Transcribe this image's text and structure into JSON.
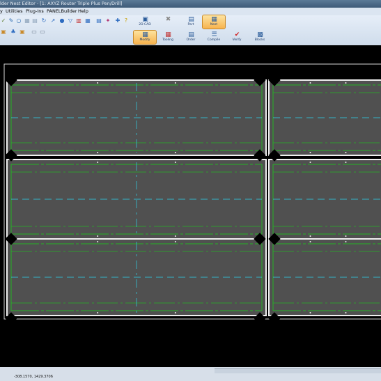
{
  "window": {
    "title": "lder Nest Editor - [1: AXYZ Router Triple Plus Pen/Drill]"
  },
  "menu": {
    "items": [
      "y",
      "Utilities",
      "Plug-Ins",
      "PANELBuilder",
      "Help"
    ]
  },
  "toolbar": {
    "row1_icons": [
      "wand-icon",
      "pencil-icon",
      "circle-icon",
      "grid-icon",
      "rotate-icon",
      "arrow-icon",
      "info-icon",
      "filter-icon",
      "ruler-icon",
      "table-icon",
      "chart-icon",
      "brush-icon",
      "text-icon",
      "help-icon"
    ],
    "row2_icons": [
      "panel-icon",
      "component-icon",
      "sheet-icon",
      "layout-icon",
      "toggle-icon"
    ]
  },
  "ribbon": {
    "top": [
      {
        "label": "2D CAD",
        "icon": "cad-icon",
        "active": false
      },
      {
        "label": "",
        "icon": "tools-icon",
        "active": false
      },
      {
        "label": "Part",
        "icon": "part-icon",
        "active": false
      },
      {
        "label": "Nest",
        "icon": "nest-icon",
        "active": true
      }
    ],
    "bottom": [
      {
        "label": "Modify",
        "icon": "modify-icon",
        "active": true
      },
      {
        "label": "Tooling",
        "icon": "tooling-icon",
        "active": false
      },
      {
        "label": "Order",
        "icon": "order-icon",
        "active": false
      },
      {
        "label": "Compile",
        "icon": "compile-icon",
        "active": false
      },
      {
        "label": "Verify",
        "icon": "verify-icon",
        "active": false
      },
      {
        "label": "Blocks",
        "icon": "blocks-icon",
        "active": false
      }
    ]
  },
  "status": {
    "coords": "-308.1570, 1429.3706"
  },
  "colors": {
    "part_fill": "#505050",
    "cut_line": "#f0f0f0",
    "green_line": "#24b324",
    "cyan_line": "#35b5c8",
    "background": "#000000"
  }
}
